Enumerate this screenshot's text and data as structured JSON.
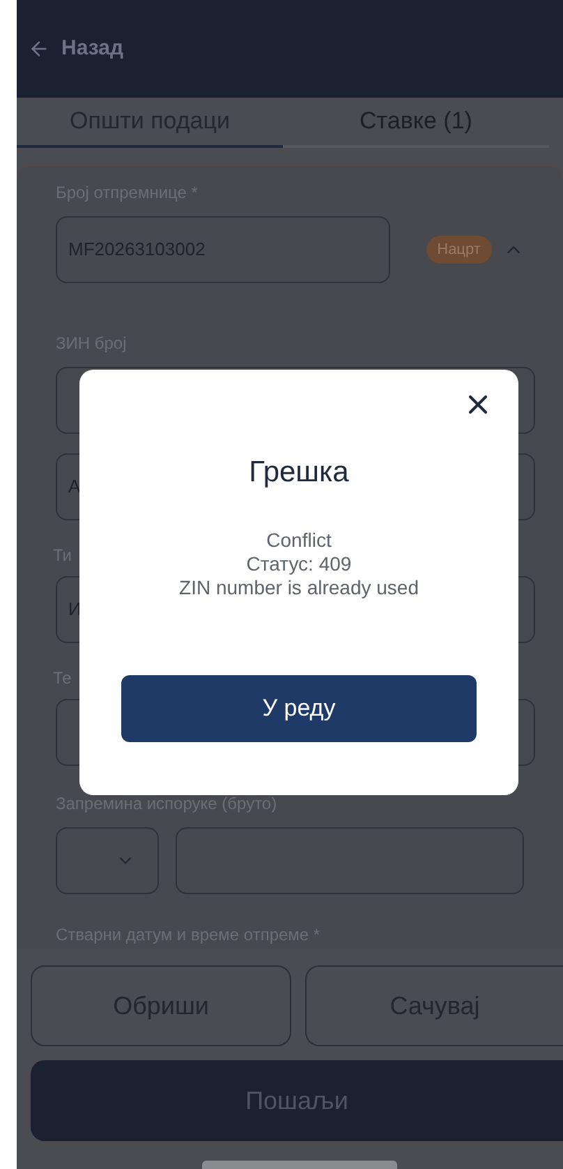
{
  "header": {
    "back_label": "Назад"
  },
  "tabs": [
    {
      "label": "Општи подаци",
      "selected": true
    },
    {
      "label": "Ставке (1)",
      "selected": false
    }
  ],
  "form": {
    "delivery_note": {
      "label": "Број отпремнице *",
      "value": "MF20263103002",
      "status": "Нацрт",
      "expanded": true
    },
    "zin": {
      "label": "ЗИН број"
    },
    "field_3": {
      "value": "А"
    },
    "field_4": {
      "label": "Ти",
      "value": "И"
    },
    "field_5": {
      "label": "Те"
    },
    "volume": {
      "label": "Запремина испоруке (бруто)"
    },
    "shipment_date": {
      "label": "Стварни датум и време отпреме *"
    }
  },
  "actions": {
    "delete": "Обриши",
    "save": "Сачувај",
    "send": "Пошаљи"
  },
  "dialog": {
    "title": "Грешка",
    "message": [
      "Conflict",
      "Статус: 409",
      "ZIN number is already used"
    ],
    "confirm": "У реду"
  }
}
